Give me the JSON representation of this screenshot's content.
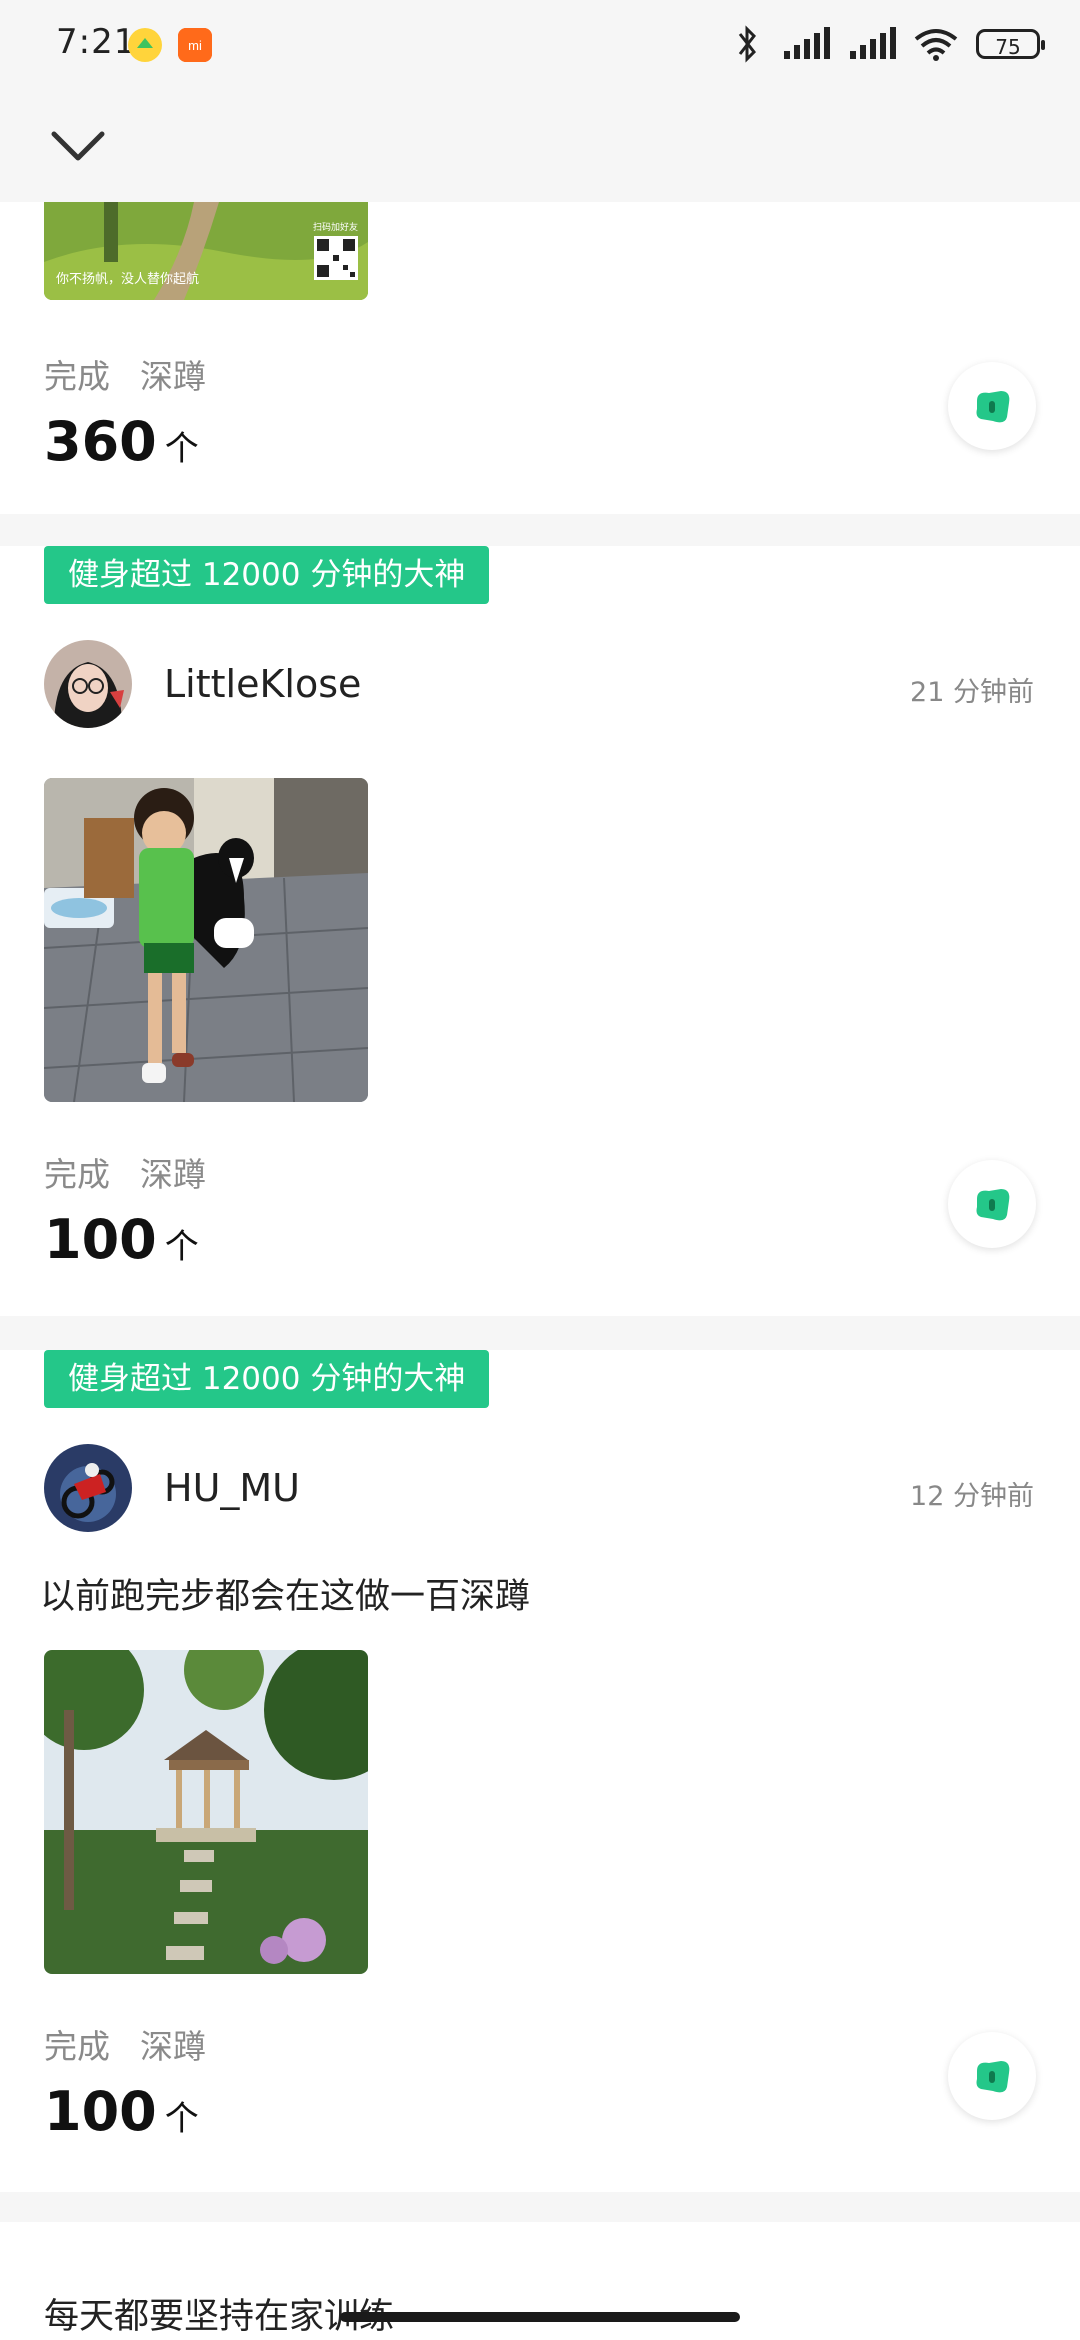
{
  "status_bar": {
    "time": "7:21",
    "battery": "75"
  },
  "header": {
    "back_icon": "chevron-down-icon"
  },
  "feed": [
    {
      "photo_caption": "你不扬帆，没人替你起航",
      "photo_qr_label": "扫码加好友",
      "label_done": "完成",
      "exercise": "深蹲",
      "count": "360",
      "unit": "个"
    },
    {
      "tag": "健身超过 12000 分钟的大神",
      "username": "LittleKlose",
      "time_ago": "21 分钟前",
      "label_done": "完成",
      "exercise": "深蹲",
      "count": "100",
      "unit": "个"
    },
    {
      "tag": "健身超过 12000 分钟的大神",
      "username": "HU_MU",
      "time_ago": "12 分钟前",
      "text": "以前跑完步都会在这做一百深蹲",
      "label_done": "完成",
      "exercise": "深蹲",
      "count": "100",
      "unit": "个"
    }
  ],
  "next_card": {
    "text": "每天都要坚持在家训练"
  },
  "colors": {
    "accent": "#24c789",
    "background": "#f6f6f6"
  }
}
